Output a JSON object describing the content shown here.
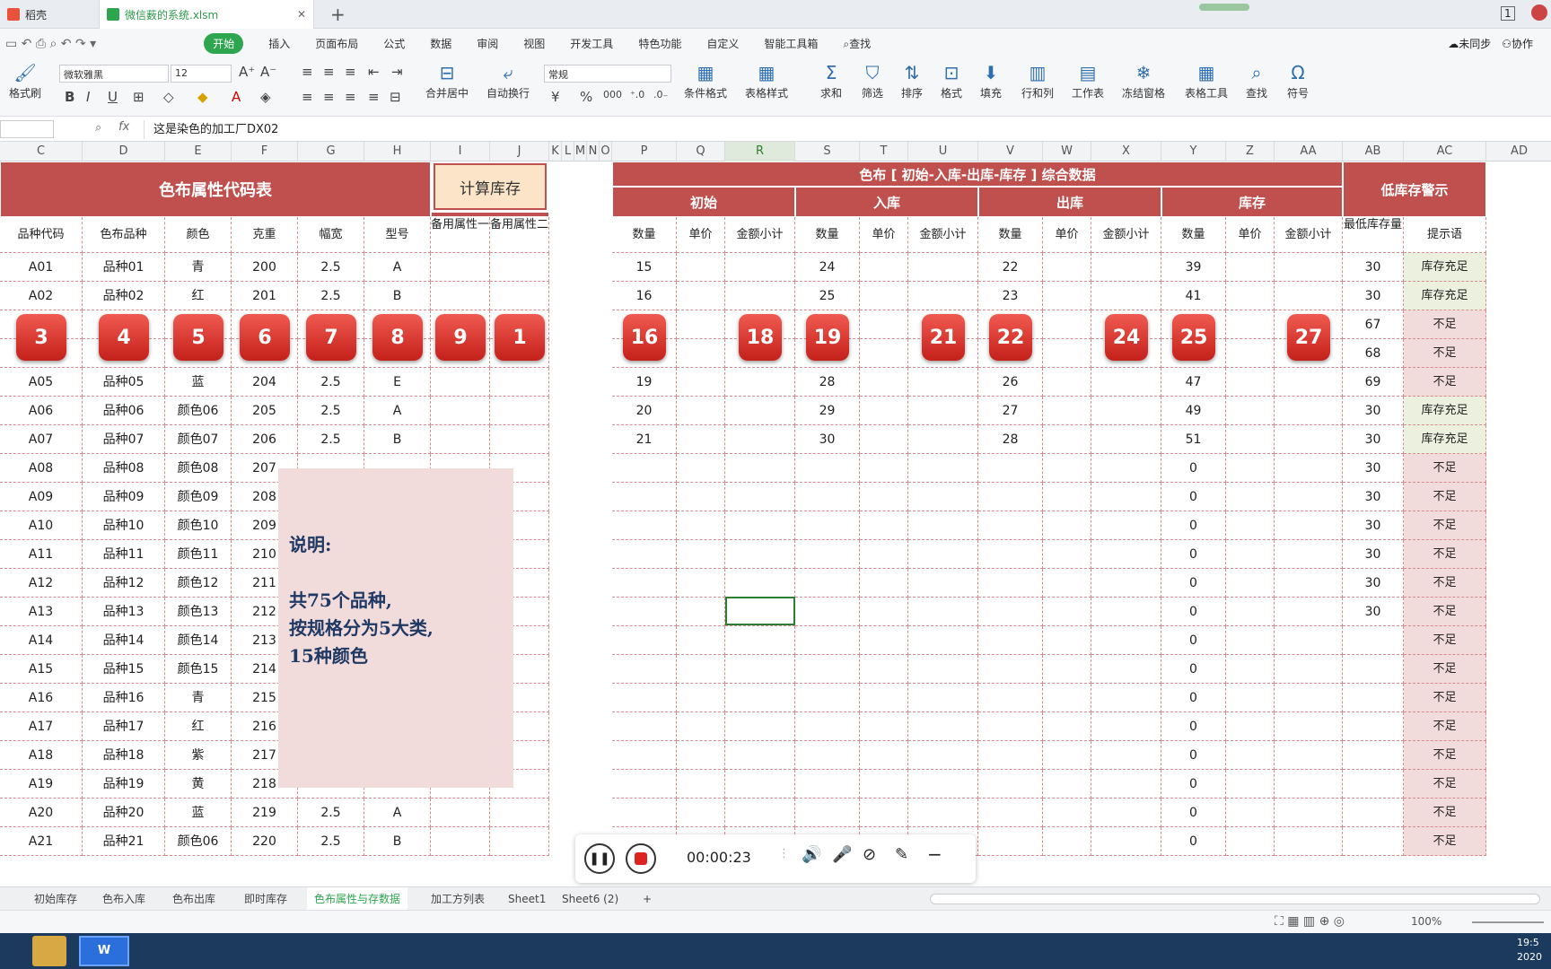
{
  "app": {
    "doc_tabs": [
      "稻壳",
      "微信薮的系统.xlsm"
    ],
    "menus": [
      "开始",
      "插入",
      "页面布局",
      "公式",
      "数据",
      "审阅",
      "视图",
      "开发工具",
      "特色功能",
      "自定义",
      "智能工具箱"
    ],
    "search_label": "查找",
    "sync_label": "未同步",
    "collab_label": "协作"
  },
  "ribbon": {
    "format_painter": "格式刷",
    "font_name": "微软雅黑",
    "font_size": "12",
    "number_format": "常规",
    "merge_center": "合并居中",
    "wrap_text": "自动换行",
    "cond_format": "条件格式",
    "table_style": "表格样式",
    "sum": "求和",
    "filter": "筛选",
    "sort": "排序",
    "format": "格式",
    "fill": "填充",
    "row_col": "行和列",
    "worksheet": "工作表",
    "freeze": "冻结窗格",
    "table_tools": "表格工具",
    "find": "查找",
    "symbol": "符号",
    "bold": "B",
    "italic": "I",
    "underline": "U",
    "currency": "¥",
    "percent": "%"
  },
  "formula_bar": {
    "fx": "fx",
    "content": "这是染色的加工厂DX02"
  },
  "columns": [
    {
      "l": "C",
      "w": 92
    },
    {
      "l": "D",
      "w": 92
    },
    {
      "l": "E",
      "w": 74
    },
    {
      "l": "F",
      "w": 74
    },
    {
      "l": "G",
      "w": 74
    },
    {
      "l": "H",
      "w": 74
    },
    {
      "l": "I",
      "w": 66
    },
    {
      "l": "J",
      "w": 66
    },
    {
      "l": "K",
      "w": 14
    },
    {
      "l": "L",
      "w": 14
    },
    {
      "l": "M",
      "w": 14
    },
    {
      "l": "N",
      "w": 14
    },
    {
      "l": "O",
      "w": 14
    },
    {
      "l": "P",
      "w": 72
    },
    {
      "l": "Q",
      "w": 54
    },
    {
      "l": "R",
      "w": 78
    },
    {
      "l": "S",
      "w": 72
    },
    {
      "l": "T",
      "w": 54
    },
    {
      "l": "U",
      "w": 78
    },
    {
      "l": "V",
      "w": 72
    },
    {
      "l": "W",
      "w": 54
    },
    {
      "l": "X",
      "w": 78
    },
    {
      "l": "Y",
      "w": 72
    },
    {
      "l": "Z",
      "w": 54
    },
    {
      "l": "AA",
      "w": 76
    },
    {
      "l": "AB",
      "w": 68
    },
    {
      "l": "AC",
      "w": 92
    },
    {
      "l": "AD",
      "w": 74
    }
  ],
  "table_left": {
    "title": "色布属性代码表",
    "button": "计算库存",
    "headers": [
      "品种代码",
      "色布品种",
      "颜色",
      "克重",
      "幅宽",
      "型号",
      "备用属性一",
      "备用属性二"
    ],
    "rows": [
      [
        "A01",
        "品种01",
        "青",
        "200",
        "2.5",
        "A",
        "",
        ""
      ],
      [
        "A02",
        "品种02",
        "红",
        "201",
        "2.5",
        "B",
        "",
        ""
      ],
      [
        "",
        "",
        "",
        "",
        "",
        "",
        "",
        ""
      ],
      [
        "",
        "",
        "",
        "",
        "",
        "",
        "",
        ""
      ],
      [
        "A05",
        "品种05",
        "蓝",
        "204",
        "2.5",
        "E",
        "",
        ""
      ],
      [
        "A06",
        "品种06",
        "颜色06",
        "205",
        "2.5",
        "A",
        "",
        ""
      ],
      [
        "A07",
        "品种07",
        "颜色07",
        "206",
        "2.5",
        "B",
        "",
        ""
      ],
      [
        "A08",
        "品种08",
        "颜色08",
        "207",
        "",
        "",
        "",
        ""
      ],
      [
        "A09",
        "品种09",
        "颜色09",
        "208",
        "",
        "",
        "",
        ""
      ],
      [
        "A10",
        "品种10",
        "颜色10",
        "209",
        "",
        "",
        "",
        ""
      ],
      [
        "A11",
        "品种11",
        "颜色11",
        "210",
        "",
        "",
        "",
        ""
      ],
      [
        "A12",
        "品种12",
        "颜色12",
        "211",
        "",
        "",
        "",
        ""
      ],
      [
        "A13",
        "品种13",
        "颜色13",
        "212",
        "",
        "",
        "",
        ""
      ],
      [
        "A14",
        "品种14",
        "颜色14",
        "213",
        "",
        "",
        "",
        ""
      ],
      [
        "A15",
        "品种15",
        "颜色15",
        "214",
        "",
        "",
        "",
        ""
      ],
      [
        "A16",
        "品种16",
        "青",
        "215",
        "",
        "",
        "",
        ""
      ],
      [
        "A17",
        "品种17",
        "红",
        "216",
        "",
        "",
        "",
        ""
      ],
      [
        "A18",
        "品种18",
        "紫",
        "217",
        "",
        "",
        "",
        ""
      ],
      [
        "A19",
        "品种19",
        "黄",
        "218",
        "2.5",
        "E",
        "",
        ""
      ],
      [
        "A20",
        "品种20",
        "蓝",
        "219",
        "2.5",
        "A",
        "",
        ""
      ],
      [
        "A21",
        "品种21",
        "颜色06",
        "220",
        "2.5",
        "B",
        "",
        ""
      ]
    ]
  },
  "table_right": {
    "title": "色布 [ 初始-入库-出库-库存 ] 综合数据",
    "groups": [
      "初始",
      "入库",
      "出库",
      "库存"
    ],
    "warn_title": "低库存警示",
    "sub_headers": [
      "数量",
      "单价",
      "金额小计",
      "数量",
      "单价",
      "金额小计",
      "数量",
      "单价",
      "金额小计",
      "数量",
      "单价",
      "金额小计",
      "最低库存量",
      "提示语"
    ],
    "rows": [
      [
        "15",
        "",
        "",
        "24",
        "",
        "",
        "22",
        "",
        "",
        "39",
        "",
        "",
        "30",
        "库存充足"
      ],
      [
        "16",
        "",
        "",
        "25",
        "",
        "",
        "23",
        "",
        "",
        "41",
        "",
        "",
        "30",
        "库存充足"
      ],
      [
        "",
        "",
        "",
        "",
        "",
        "",
        "",
        "",
        "",
        "",
        "",
        "",
        "67",
        "不足"
      ],
      [
        "",
        "",
        "",
        "",
        "",
        "",
        "",
        "",
        "",
        "",
        "",
        "",
        "68",
        "不足"
      ],
      [
        "19",
        "",
        "",
        "28",
        "",
        "",
        "26",
        "",
        "",
        "47",
        "",
        "",
        "69",
        "不足"
      ],
      [
        "20",
        "",
        "",
        "29",
        "",
        "",
        "27",
        "",
        "",
        "49",
        "",
        "",
        "30",
        "库存充足"
      ],
      [
        "21",
        "",
        "",
        "30",
        "",
        "",
        "28",
        "",
        "",
        "51",
        "",
        "",
        "30",
        "库存充足"
      ],
      [
        "",
        "",
        "",
        "",
        "",
        "",
        "",
        "",
        "",
        "0",
        "",
        "",
        "30",
        "不足"
      ],
      [
        "",
        "",
        "",
        "",
        "",
        "",
        "",
        "",
        "",
        "0",
        "",
        "",
        "30",
        "不足"
      ],
      [
        "",
        "",
        "",
        "",
        "",
        "",
        "",
        "",
        "",
        "0",
        "",
        "",
        "30",
        "不足"
      ],
      [
        "",
        "",
        "",
        "",
        "",
        "",
        "",
        "",
        "",
        "0",
        "",
        "",
        "30",
        "不足"
      ],
      [
        "",
        "",
        "",
        "",
        "",
        "",
        "",
        "",
        "",
        "0",
        "",
        "",
        "30",
        "不足"
      ],
      [
        "",
        "",
        "",
        "",
        "",
        "",
        "",
        "",
        "",
        "0",
        "",
        "",
        "30",
        "不足"
      ],
      [
        "",
        "",
        "",
        "",
        "",
        "",
        "",
        "",
        "",
        "0",
        "",
        "",
        "",
        "不足"
      ],
      [
        "",
        "",
        "",
        "",
        "",
        "",
        "",
        "",
        "",
        "0",
        "",
        "",
        "",
        "不足"
      ],
      [
        "",
        "",
        "",
        "",
        "",
        "",
        "",
        "",
        "",
        "0",
        "",
        "",
        "",
        "不足"
      ],
      [
        "",
        "",
        "",
        "",
        "",
        "",
        "",
        "",
        "",
        "0",
        "",
        "",
        "",
        "不足"
      ],
      [
        "",
        "",
        "",
        "",
        "",
        "",
        "",
        "",
        "",
        "0",
        "",
        "",
        "",
        "不足"
      ],
      [
        "",
        "",
        "",
        "",
        "",
        "",
        "",
        "",
        "",
        "0",
        "",
        "",
        "",
        "不足"
      ],
      [
        "",
        "",
        "",
        "",
        "",
        "",
        "",
        "",
        "",
        "0",
        "",
        "",
        "",
        "不足"
      ],
      [
        "",
        "",
        "",
        "",
        "",
        "",
        "",
        "",
        "",
        "0",
        "",
        "",
        "",
        "不足"
      ]
    ]
  },
  "badges_left": [
    "3",
    "4",
    "5",
    "6",
    "7",
    "8",
    "9",
    "1"
  ],
  "badges_right": [
    "16",
    "18",
    "19",
    "21",
    "22",
    "24",
    "25",
    "27"
  ],
  "note": {
    "line1": "说明:",
    "line2": "共75个品种,",
    "line3": "按规格分为5大类,",
    "line4": "15种颜色"
  },
  "recorder": {
    "time": "00:00:23"
  },
  "sheet_tabs": [
    "初始库存",
    "色布入库",
    "色布出库",
    "即时库存",
    "色布属性与存数据",
    "加工方列表",
    "Sheet1",
    "Sheet6 (2)"
  ],
  "status": {
    "zoom": "100%"
  },
  "taskbar": {
    "clock": "19:5",
    "year": "2020"
  }
}
